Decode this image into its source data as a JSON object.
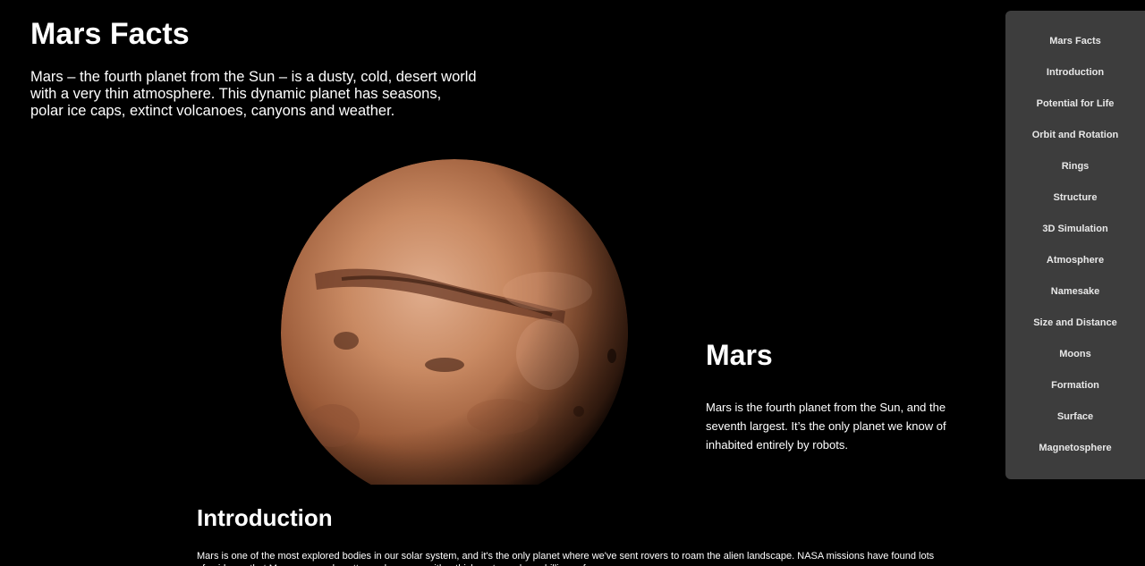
{
  "hero": {
    "title": "Mars Facts",
    "text": "Mars – the fourth planet from the Sun – is a dusty, cold, desert world with a very thin atmosphere. This dynamic planet has seasons, polar ice caps, extinct volcanoes, canyons and weather."
  },
  "mars": {
    "title": "Mars",
    "text": "Mars is the fourth planet from the Sun, and the seventh largest. It’s the only planet we know of inhabited entirely by robots."
  },
  "intro": {
    "title": "Introduction",
    "text": "Mars is one of the most explored bodies in our solar system, and it's the only planet where we've sent rovers to roam the alien landscape. NASA missions have found lots of evidence that Mars was much wetter and warmer, with a thicker atmosphere, billions of years ago."
  },
  "nav": {
    "items": [
      "Mars Facts",
      "Introduction",
      "Potential for Life",
      "Orbit and Rotation",
      "Rings",
      "Structure",
      "3D Simulation",
      "Atmosphere",
      "Namesake",
      "Size and Distance",
      "Moons",
      "Formation",
      "Surface",
      "Magnetosphere"
    ]
  },
  "colors": {
    "background": "#000000",
    "sidebar": "#3d3d3d",
    "planet": "#c07a55"
  }
}
